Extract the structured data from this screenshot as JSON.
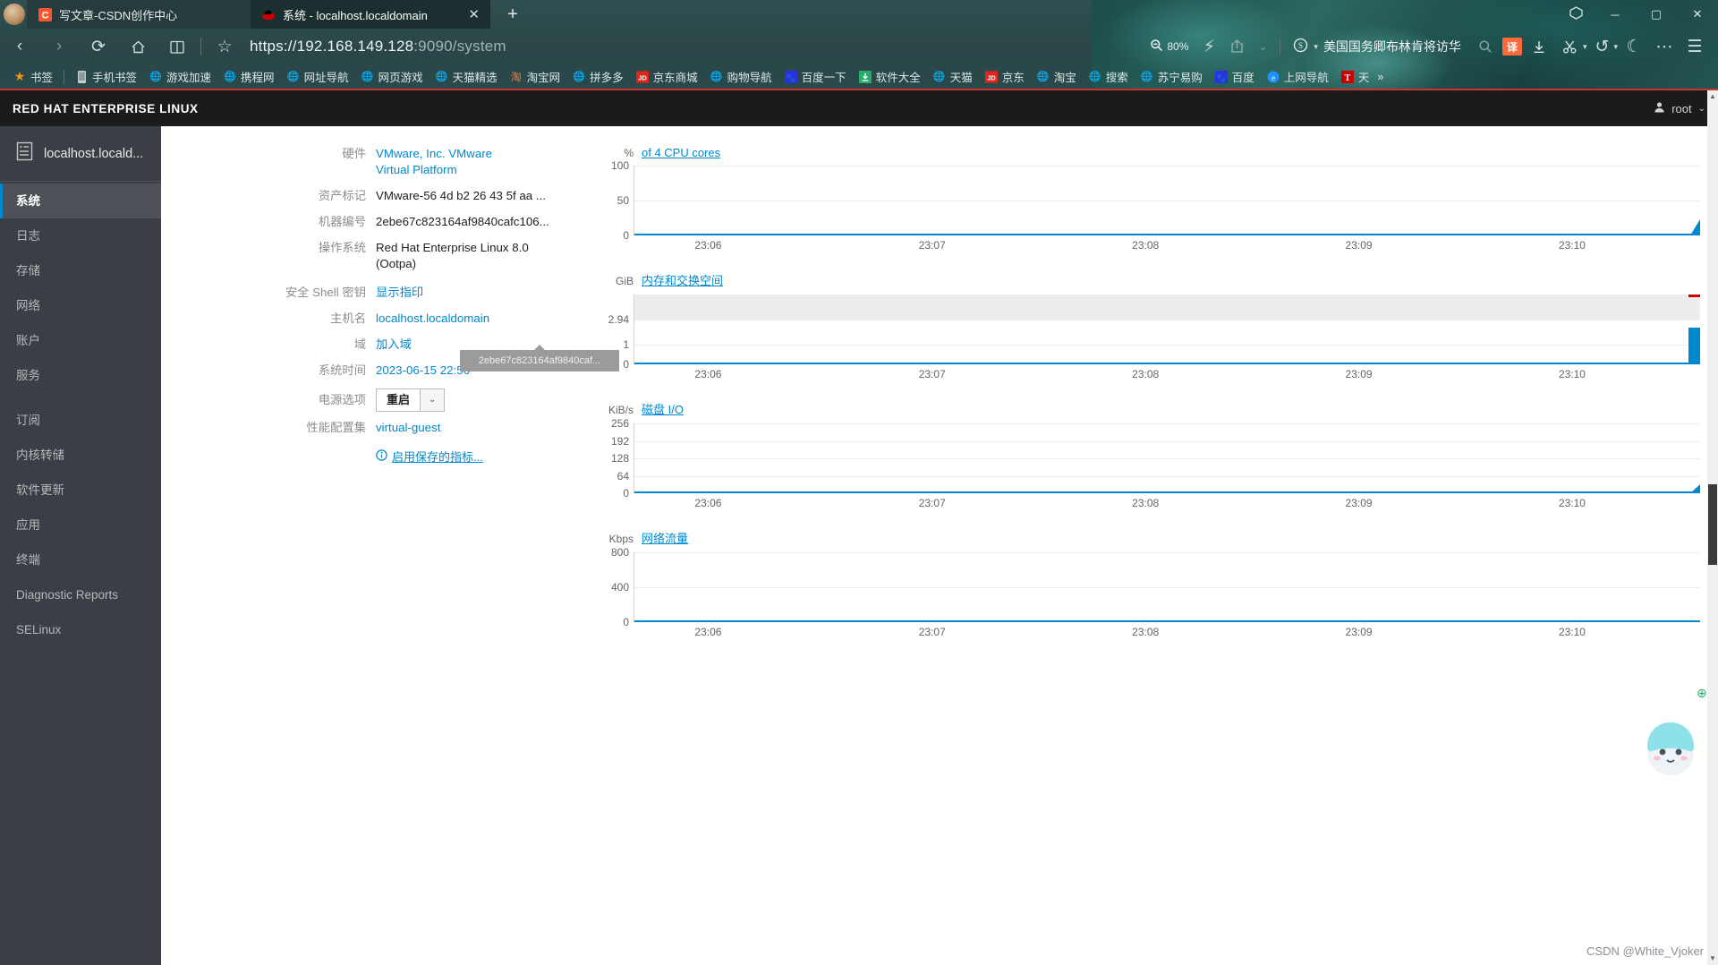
{
  "browser": {
    "tabs": [
      {
        "title": "写文章-CSDN创作中心",
        "favicon": "csdn-icon",
        "active": false
      },
      {
        "title": "系统 - localhost.localdomain",
        "favicon": "redhat-icon",
        "active": true
      }
    ],
    "new_tab_label": "+",
    "window_controls": {
      "minimize": "─",
      "maximize": "▢",
      "close": "✕"
    },
    "nav": {
      "back": "‹",
      "forward": "›",
      "reload": "⟳",
      "home": "⌂",
      "reading": "▯▯",
      "bookmark_star": "☆"
    },
    "url": {
      "scheme": "https://",
      "host": "192.168.149.128",
      "port_path": ":9090/system"
    },
    "zoom": {
      "label": "80%",
      "icon": "zoom-out-icon"
    },
    "toolbar_right": {
      "lightning": "⚡",
      "share": "⬈",
      "chevron": "⌄",
      "search_engine": "S",
      "search_text": "美国国务卿布林肯将访华",
      "search_icon": "search-icon",
      "translate_badge": "译",
      "download": "⬇",
      "screenshot": "✂",
      "history": "↺",
      "moon": "☾",
      "more": "⋯",
      "menu": "☰",
      "extensions": "⬡"
    },
    "bookmarks": [
      {
        "label": "书签",
        "icon": "star-icon",
        "color": "#f0961e"
      },
      {
        "label": "手机书签",
        "icon": "phone-icon",
        "color": "#c7cdcd"
      },
      {
        "label": "游戏加速",
        "icon": "globe-icon",
        "color": "#b9c4c4"
      },
      {
        "label": "携程网",
        "icon": "globe-icon",
        "color": "#b9c4c4"
      },
      {
        "label": "网址导航",
        "icon": "globe-icon",
        "color": "#b9c4c4"
      },
      {
        "label": "网页游戏",
        "icon": "globe-icon",
        "color": "#b9c4c4"
      },
      {
        "label": "天猫精选",
        "icon": "globe-icon",
        "color": "#b9c4c4"
      },
      {
        "label": "淘宝网",
        "icon": "taobao-icon",
        "color": "#ff5000"
      },
      {
        "label": "拼多多",
        "icon": "globe-icon",
        "color": "#b9c4c4"
      },
      {
        "label": "京东商城",
        "icon": "jd-icon",
        "color": "#e1251b"
      },
      {
        "label": "购物导航",
        "icon": "globe-icon",
        "color": "#b9c4c4"
      },
      {
        "label": "百度一下",
        "icon": "baidu-icon",
        "color": "#2932e1"
      },
      {
        "label": "软件大全",
        "icon": "download-green-icon",
        "color": "#2aa96b"
      },
      {
        "label": "天猫",
        "icon": "globe-icon",
        "color": "#b9c4c4"
      },
      {
        "label": "京东",
        "icon": "jd-icon",
        "color": "#e1251b"
      },
      {
        "label": "淘宝",
        "icon": "globe-icon",
        "color": "#b9c4c4"
      },
      {
        "label": "搜索",
        "icon": "globe-icon",
        "color": "#b9c4c4"
      },
      {
        "label": "苏宁易购",
        "icon": "globe-icon",
        "color": "#b9c4c4"
      },
      {
        "label": "百度",
        "icon": "baidu-icon",
        "color": "#2932e1"
      },
      {
        "label": "上网导航",
        "icon": "e-icon",
        "color": "#1e90ff"
      },
      {
        "label": "天",
        "icon": "t-icon",
        "color": "#cc0000"
      }
    ],
    "bookmarks_overflow": "»"
  },
  "cockpit": {
    "header": {
      "title": "RED HAT ENTERPRISE LINUX",
      "user": "root",
      "user_icon": "user-icon",
      "caret": "⌄"
    },
    "sidebar": {
      "host": "localhost.locald...",
      "host_icon": "server-icon",
      "items": [
        {
          "label": "系统",
          "active": true
        },
        {
          "label": "日志",
          "active": false
        },
        {
          "label": "存储",
          "active": false
        },
        {
          "label": "网络",
          "active": false
        },
        {
          "label": "账户",
          "active": false
        },
        {
          "label": "服务",
          "active": false
        },
        {
          "label": "订阅",
          "active": false,
          "gap_before": true
        },
        {
          "label": "内核转储",
          "active": false
        },
        {
          "label": "软件更新",
          "active": false
        },
        {
          "label": "应用",
          "active": false
        },
        {
          "label": "终端",
          "active": false
        },
        {
          "label": "Diagnostic Reports",
          "active": false
        },
        {
          "label": "SELinux",
          "active": false
        }
      ]
    },
    "system_info": {
      "hardware": {
        "label": "硬件",
        "value": "VMware, Inc. VMware Virtual Platform"
      },
      "asset_tag": {
        "label": "资产标记",
        "value": "VMware-56 4d b2 26 43 5f aa ..."
      },
      "machine_id": {
        "label": "机器编号",
        "value": "2ebe67c823164af9840cafc106..."
      },
      "operating_system": {
        "label": "操作系统",
        "value": "Red Hat Enterprise Linux 8.0 (Ootpa)"
      },
      "ssh_key": {
        "label": "安全 Shell 密钥",
        "value": "显示指印"
      },
      "hostname": {
        "label": "主机名",
        "value": "localhost.localdomain"
      },
      "domain": {
        "label": "域",
        "value": "加入域"
      },
      "system_time": {
        "label": "系统时间",
        "value": "2023-06-15 22:56"
      },
      "power_options": {
        "label": "电源选项",
        "value": "重启",
        "caret": "⌄"
      },
      "performance_profile": {
        "label": "性能配置集",
        "value": "virtual-guest"
      },
      "metrics_link": {
        "label": "启用保存的指标...",
        "icon": "info-icon"
      },
      "tooltip": "2ebe67c823164af9840caf..."
    },
    "chart_data": [
      {
        "type": "line",
        "title": "of 4 CPU cores",
        "ylabel": "%",
        "yticks": [
          0,
          50,
          100
        ],
        "ylim": [
          0,
          100
        ],
        "xticks": [
          "23:06",
          "23:07",
          "23:08",
          "23:09",
          "23:10"
        ],
        "series": [
          {
            "name": "cpu",
            "values": [
              0,
              0,
              0,
              0,
              0,
              0,
              0,
              0,
              0,
              18
            ],
            "color": "#0088ce"
          }
        ],
        "grid": true,
        "legend": "none"
      },
      {
        "type": "area",
        "title": "内存和交换空间",
        "ylabel": "GiB",
        "yticks": [
          0,
          1,
          2.94
        ],
        "ylim": [
          0,
          3.6
        ],
        "xticks": [
          "23:06",
          "23:07",
          "23:08",
          "23:09",
          "23:10"
        ],
        "series": [
          {
            "name": "memory",
            "values": [
              0,
              0,
              0,
              0,
              0,
              0,
              0,
              0,
              0,
              1.35
            ],
            "color": "#0088ce"
          },
          {
            "name": "swap",
            "values": [
              0,
              0,
              0,
              0,
              0,
              0,
              0,
              0,
              0,
              2.94
            ],
            "color": "#cc0000"
          }
        ],
        "grid": true,
        "legend": "none"
      },
      {
        "type": "line",
        "title": "磁盘 I/O",
        "ylabel": "KiB/s",
        "yticks": [
          0,
          64,
          128,
          192,
          256
        ],
        "ylim": [
          0,
          256
        ],
        "xticks": [
          "23:06",
          "23:07",
          "23:08",
          "23:09",
          "23:10"
        ],
        "series": [
          {
            "name": "disk",
            "values": [
              0,
              0,
              0,
              0,
              0,
              0,
              0,
              0,
              0,
              24
            ],
            "color": "#0088ce"
          }
        ],
        "grid": true,
        "legend": "none"
      },
      {
        "type": "line",
        "title": "网络流量",
        "ylabel": "Kbps",
        "yticks": [
          0,
          400,
          800
        ],
        "ylim": [
          0,
          800
        ],
        "xticks": [
          "23:06",
          "23:07",
          "23:08",
          "23:09",
          "23:10"
        ],
        "series": [
          {
            "name": "network",
            "values": [
              0,
              0,
              0,
              0,
              0,
              0,
              0,
              0,
              0,
              4
            ],
            "color": "#0088ce"
          }
        ],
        "grid": true,
        "legend": "none"
      }
    ],
    "watermark": "CSDN @White_Vjoker"
  }
}
